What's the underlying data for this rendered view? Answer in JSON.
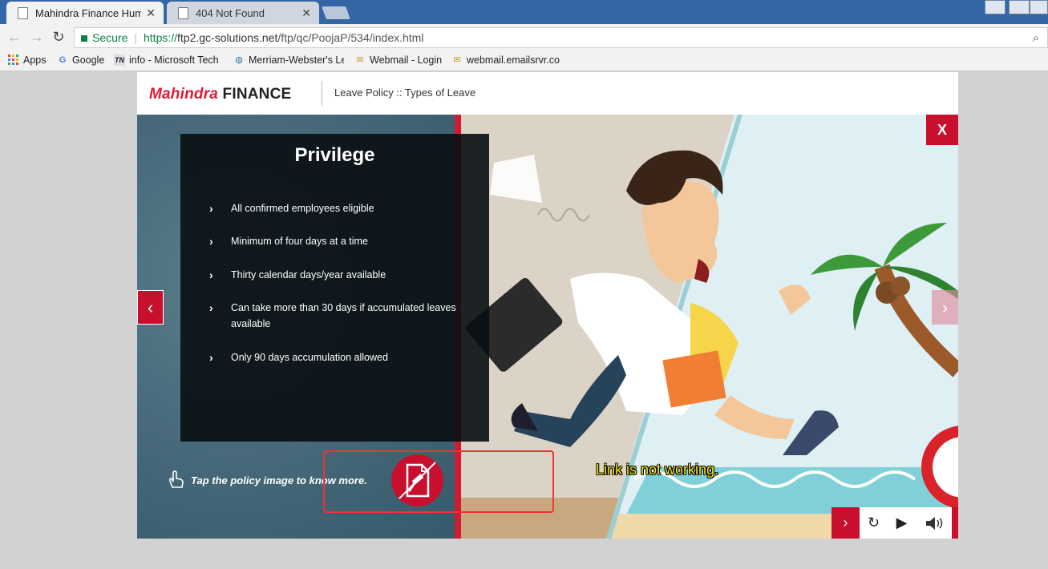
{
  "browser": {
    "tabs": [
      {
        "title": "Mahindra Finance Huma",
        "active": true
      },
      {
        "title": "404 Not Found",
        "active": false
      }
    ],
    "address": {
      "secure_label": "Secure",
      "url_scheme": "https://",
      "url_host": "ftp2.gc-solutions.net",
      "url_path": "/ftp/qc/PoojaP/534/index.html"
    },
    "bookmarks": [
      {
        "label": "Apps",
        "icon": "apps-grid-icon"
      },
      {
        "label": "Google",
        "icon": "google-icon"
      },
      {
        "label": "info - Microsoft Tech",
        "icon": "tn-icon"
      },
      {
        "label": "Merriam-Webster's Le",
        "icon": "globe-icon"
      },
      {
        "label": "Webmail - Login",
        "icon": "mail-icon"
      },
      {
        "label": "webmail.emailsrvr.co",
        "icon": "mail-icon"
      }
    ]
  },
  "course": {
    "brand_mahindra": "Mahindra",
    "brand_finance": "FINANCE",
    "breadcrumb": "Leave Policy :: Types of Leave",
    "close_label": "X",
    "panel": {
      "title": "Privilege",
      "bullets": [
        "All confirmed employees eligible",
        "Minimum of four days at a time",
        "Thirty calendar days/year available",
        "Can take more than 30 days if accumulated leaves available",
        "Only 90 days accumulation allowed"
      ]
    },
    "tap_hint": "Tap the policy image to know more.",
    "annotation": "Link is not working.",
    "colors": {
      "accent": "#c8102e",
      "annotation": "#f5e31b"
    }
  }
}
